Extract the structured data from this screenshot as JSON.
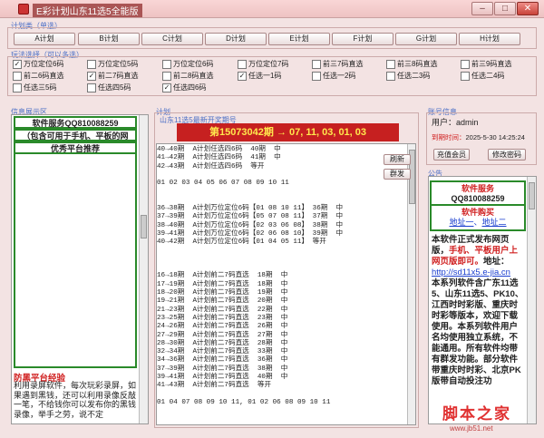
{
  "window": {
    "title": "E彩计划山东11选5全能版",
    "minimize": "–",
    "maximize": "□",
    "close": "✕"
  },
  "plan_group": {
    "label": "计划类（单选）",
    "buttons": [
      "A计划",
      "B计划",
      "C计划",
      "D计划",
      "E计划",
      "F计划",
      "G计划",
      "H计划"
    ]
  },
  "play_group": {
    "label": "玩法选择（可以多选）",
    "rows": [
      [
        {
          "label": "万位定位6码",
          "checked": true
        },
        {
          "label": "万位定位5码",
          "checked": false
        },
        {
          "label": "万位定位6码",
          "checked": false
        },
        {
          "label": "万位定位7码",
          "checked": false
        },
        {
          "label": "前三7码直选",
          "checked": false
        },
        {
          "label": "前三8码直选",
          "checked": false
        },
        {
          "label": "前三9码直选",
          "checked": false
        }
      ],
      [
        {
          "label": "前二6码直选",
          "checked": false
        },
        {
          "label": "前二7码直选",
          "checked": true
        },
        {
          "label": "前二8码直选",
          "checked": false
        },
        {
          "label": "任选一1码",
          "checked": true
        },
        {
          "label": "任选一2码",
          "checked": false
        },
        {
          "label": "任选二3码",
          "checked": false
        },
        {
          "label": "任选二4码",
          "checked": false
        }
      ],
      [
        {
          "label": "任选三5码",
          "checked": false
        },
        {
          "label": "任选四5码",
          "checked": false
        },
        {
          "label": "任选四6码",
          "checked": true
        }
      ]
    ]
  },
  "info_section": {
    "label": "信息展示区",
    "service_title": "软件服务QQ810088259",
    "service_sub": "（包含可用于手机、平板的网",
    "recommend": "优秀平台推荐",
    "fraud_title": "防黑平台经验",
    "fraud_text": "利用录屏软件，每次玩彩录屏，如果遇到黑钱，还可以利用录像反敲一笔，不给钱你可以发布你的黑钱录像，举手之劳，说不定"
  },
  "plan_section": {
    "label": "计划",
    "sublabel": "山东11选5最新开奖期号",
    "banner": "第15073042期 → 07, 11, 03, 01, 03",
    "refresh_btn": "刷新",
    "group_btn": "群发",
    "text": "40→40期  A计划任选四6码  40期  中\n41→42期  A计划任选四6码  41期  中\n42→43期  A计划任选四6码  等开\n\n01 02 03 04 05 06 07 08 09 10 11\n\n\n36→38期  A计划万位定位6码【01 08 10 11】 36期  中\n37→39期  A计划万位定位6码【05 07 08 11】 37期  中\n38→40期  A计划万位定位6码【02 03 06 08】 38期  中\n39→41期  A计划万位定位6码【02 06 08 10】 39期  中\n40→42期  A计划万位定位6码【01 04 05 11】 等开\n\n\n\n16→18期  A计划前二7码直选  18期  中\n17→19期  A计划前二7码直选  18期  中\n18→20期  A计划前二7码直选  19期  中\n19→21期  A计划前二7码直选  20期  中\n21→23期  A计划前二7码直选  22期  中\n23→25期  A计划前二7码直选  23期  中\n24→26期  A计划前二7码直选  26期  中\n27→29期  A计划前二7码直选  27期  中\n28→30期  A计划前二7码直选  28期  中\n32→34期  A计划前二7码直选  33期  中\n34→36期  A计划前二7码直选  36期  中\n37→39期  A计划前二7码直选  38期  中\n39→41期  A计划前二7码直选  40期  中\n41→43期  A计划前二7码直选  等开\n\n01 04 07 08 09 10 11, 01 02 06 08 09 10 11\n"
  },
  "account": {
    "label": "账号信息",
    "user_label": "用户：",
    "user": "admin",
    "expiry_label": "到期时间：",
    "expiry": "2025-5-30 14:25:24",
    "recharge_btn": "充值会员",
    "change_pw_btn": "修改密码"
  },
  "notice": {
    "label": "公告",
    "service_title": "软件服务",
    "qq": "QQ810088259",
    "buy_title": "软件购买",
    "addr1": "地址一",
    "addr2": "地址二",
    "body1": "本软件正式发布网页版，",
    "body_red": "手机、平板用户上网页版即可。",
    "body2": "地址：",
    "url": "http://sd11x5.e-jia.cn",
    "body3": "本系列软件含广东11选5、山东11选5、PK10、江西时时彩版、重庆时时彩等版本，欢迎下载使用。本系列软件用户名均使用独立系统，不能通用。所有软件均带有群发功能。部分软件带重庆时时彩、北京PK版带自动投注功"
  },
  "watermark": {
    "main": "脚本之家",
    "site": "www.jb51.net"
  }
}
